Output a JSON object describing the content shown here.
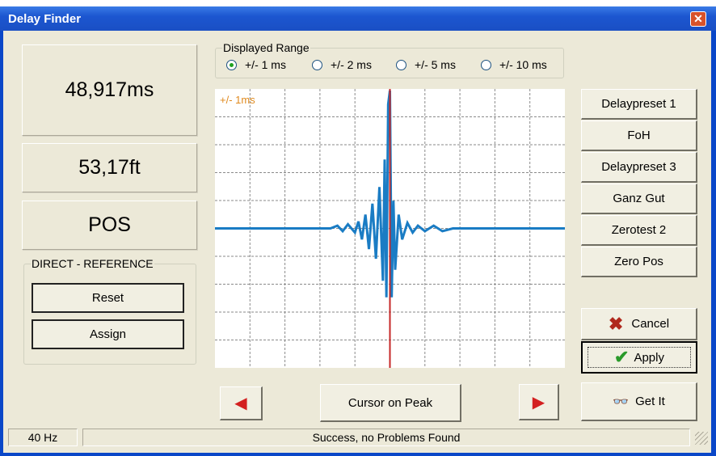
{
  "window": {
    "title": "Delay Finder",
    "close_icon": "close-icon"
  },
  "readouts": {
    "delay_ms": "48,917ms",
    "distance_ft": "53,17ft",
    "mode": "POS"
  },
  "direct_reference": {
    "label": "DIRECT - REFERENCE",
    "reset": "Reset",
    "assign": "Assign"
  },
  "range": {
    "label": "Displayed Range",
    "options": [
      "+/- 1 ms",
      "+/- 2 ms",
      "+/- 5 ms",
      "+/- 10 ms"
    ],
    "selected": 0
  },
  "presets": [
    "Delaypreset 1",
    "FoH",
    "Delaypreset 3",
    "Ganz Gut",
    "Zerotest 2",
    "Zero Pos"
  ],
  "actions": {
    "cancel": "Cancel",
    "apply": "Apply",
    "get_it": "Get It"
  },
  "nav": {
    "cursor_on_peak": "Cursor on Peak",
    "left_icon": "arrow-left-icon",
    "right_icon": "arrow-right-icon"
  },
  "status": {
    "frequency": "40 Hz",
    "message": "Success, no Problems Found"
  },
  "colors": {
    "trace": "#1a7cc4",
    "cursor": "#c62828",
    "range_label": "#e08a1e"
  },
  "chart_data": {
    "type": "line",
    "title": "+/- 1ms",
    "xlim": [
      -1,
      1
    ],
    "ylim": [
      -1,
      1
    ],
    "grid": true,
    "grid_divisions": 10,
    "cursor_x": 0,
    "x": [
      -1,
      -0.34,
      -0.3,
      -0.27,
      -0.24,
      -0.2,
      -0.18,
      -0.16,
      -0.14,
      -0.12,
      -0.1,
      -0.08,
      -0.06,
      -0.04,
      -0.03,
      -0.02,
      -0.01,
      0.0,
      0.01,
      0.02,
      0.03,
      0.05,
      0.07,
      0.1,
      0.13,
      0.16,
      0.2,
      0.25,
      0.3,
      0.36,
      1
    ],
    "y": [
      0,
      0,
      0.02,
      -0.02,
      0.03,
      -0.03,
      0.05,
      -0.08,
      0.1,
      -0.15,
      0.18,
      -0.22,
      0.3,
      -0.38,
      0.5,
      -0.5,
      0.9,
      1.0,
      -0.5,
      0.2,
      -0.3,
      0.1,
      -0.08,
      0.04,
      -0.03,
      0.02,
      -0.02,
      0.02,
      -0.02,
      0,
      0
    ]
  }
}
